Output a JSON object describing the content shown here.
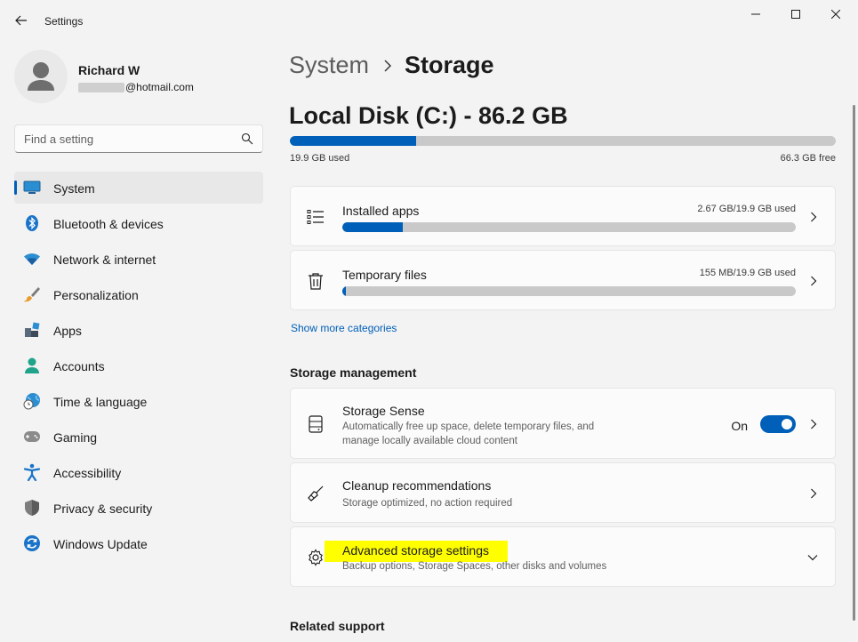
{
  "window": {
    "title": "Settings"
  },
  "profile": {
    "name": "Richard W",
    "email_domain": "@hotmail.com"
  },
  "search": {
    "placeholder": "Find a setting"
  },
  "nav": {
    "items": [
      {
        "label": "System",
        "icon": "monitor-icon",
        "active": true
      },
      {
        "label": "Bluetooth & devices",
        "icon": "bluetooth-icon"
      },
      {
        "label": "Network & internet",
        "icon": "wifi-icon"
      },
      {
        "label": "Personalization",
        "icon": "brush-icon"
      },
      {
        "label": "Apps",
        "icon": "apps-icon"
      },
      {
        "label": "Accounts",
        "icon": "person-icon"
      },
      {
        "label": "Time & language",
        "icon": "globe-clock-icon"
      },
      {
        "label": "Gaming",
        "icon": "gamepad-icon"
      },
      {
        "label": "Accessibility",
        "icon": "accessibility-icon"
      },
      {
        "label": "Privacy & security",
        "icon": "shield-icon"
      },
      {
        "label": "Windows Update",
        "icon": "update-icon"
      }
    ]
  },
  "breadcrumb": {
    "parent": "System",
    "current": "Storage"
  },
  "disk": {
    "title": "Local Disk (C:) - 86.2 GB",
    "used_label": "19.9 GB used",
    "free_label": "66.3 GB free",
    "used_fraction": 0.231
  },
  "categories": [
    {
      "title": "Installed apps",
      "meta": "2.67 GB/19.9 GB used",
      "fraction": 0.134,
      "icon": "list-icon"
    },
    {
      "title": "Temporary files",
      "meta": "155 MB/19.9 GB used",
      "fraction": 0.008,
      "icon": "trash-icon"
    }
  ],
  "show_more": "Show more categories",
  "storage_management": {
    "heading": "Storage management",
    "storage_sense": {
      "title": "Storage Sense",
      "desc_line1": "Automatically free up space, delete temporary files, and",
      "desc_line2": "manage locally available cloud content",
      "toggle_label": "On",
      "toggle_on": true
    },
    "cleanup": {
      "title": "Cleanup recommendations",
      "desc": "Storage optimized, no action required"
    },
    "advanced": {
      "title": "Advanced storage settings",
      "desc": "Backup options, Storage Spaces, other disks and volumes"
    }
  },
  "related": {
    "heading": "Related support"
  },
  "colors": {
    "accent": "#005fb8",
    "highlight": "#ffff00",
    "bar_bg": "#c9c9c9"
  }
}
